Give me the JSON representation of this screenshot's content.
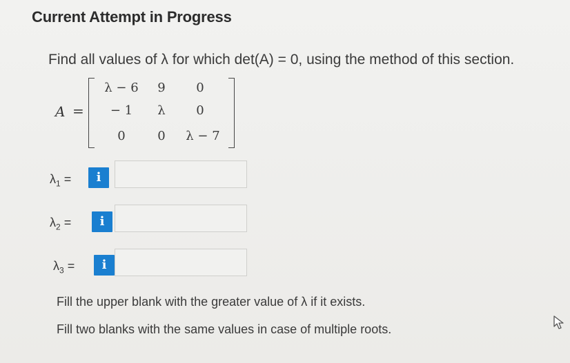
{
  "header": {
    "title": "Current Attempt in Progress"
  },
  "question": {
    "text": "Find all values of λ for which det(A) = 0, using the method of this section."
  },
  "matrix": {
    "label": "A",
    "equals": "=",
    "rows": [
      [
        "λ − 6",
        "9",
        "0"
      ],
      [
        "− 1",
        "λ",
        "0"
      ],
      [
        "0",
        "0",
        "λ − 7"
      ]
    ]
  },
  "answers": [
    {
      "symbol": "λ",
      "subscript": "1",
      "equals": "=",
      "info_icon": "i",
      "value": ""
    },
    {
      "symbol": "λ",
      "subscript": "2",
      "equals": "=",
      "info_icon": "i",
      "value": ""
    },
    {
      "symbol": "λ",
      "subscript": "3",
      "equals": "=",
      "info_icon": "i",
      "value": ""
    }
  ],
  "hints": [
    "Fill the upper blank with the greater value of λ if it exists.",
    "Fill two blanks with the same values in case of multiple roots."
  ],
  "icons": {
    "info": "info-icon",
    "cursor": "mouse-pointer-icon"
  },
  "colors": {
    "info_button": "#1a7fd0"
  }
}
